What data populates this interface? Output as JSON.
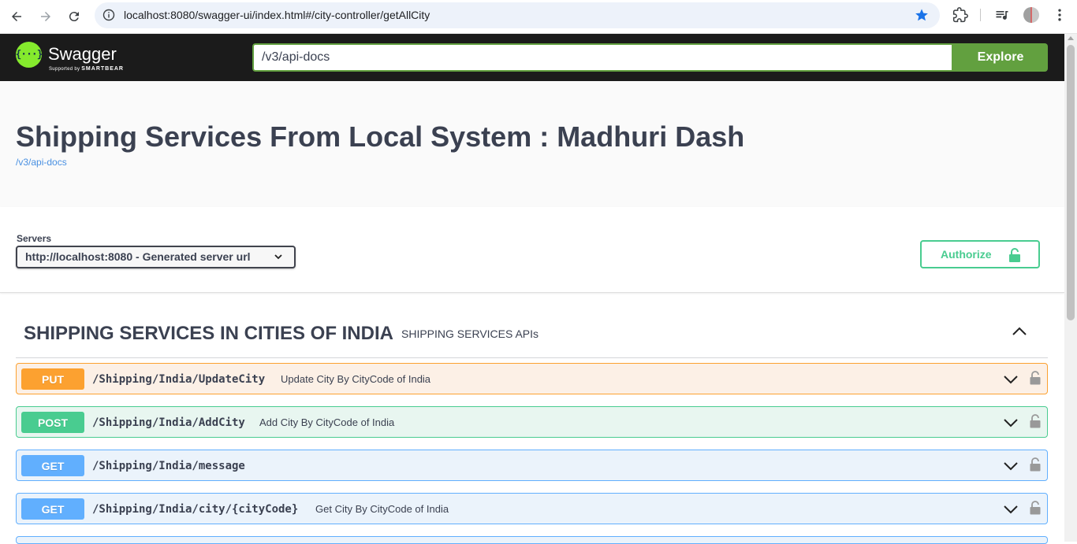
{
  "browser": {
    "url": "localhost:8080/swagger-ui/index.html#/city-controller/getAllCity",
    "icons": [
      "back-icon",
      "forward-icon",
      "reload-icon",
      "site-info-icon",
      "bookmark-star-icon",
      "extensions-icon",
      "media-control-icon",
      "profile-avatar",
      "more-menu-icon"
    ]
  },
  "topbar": {
    "logo_text": "Swagger",
    "logo_sub_prefix": "Supported by",
    "logo_sub_brand": "SMARTBEAR",
    "logo_glyph": "{···}",
    "spec_url": "/v3/api-docs",
    "explore_label": "Explore"
  },
  "info": {
    "title": "Shipping Services From Local System : Madhuri Dash",
    "spec_link": "/v3/api-docs"
  },
  "servers": {
    "label": "Servers",
    "selected": "http://localhost:8080 - Generated server url",
    "authorize_label": "Authorize"
  },
  "tag": {
    "name": "SHIPPING SERVICES IN CITIES OF INDIA",
    "description": "SHIPPING SERVICES APIs"
  },
  "operations": [
    {
      "method": "PUT",
      "path": "/Shipping/India/UpdateCity",
      "summary": "Update City By CityCode of India",
      "color": "#fca130"
    },
    {
      "method": "POST",
      "path": "/Shipping/India/AddCity",
      "summary": "Add City By CityCode of India",
      "color": "#49cc90"
    },
    {
      "method": "GET",
      "path": "/Shipping/India/message",
      "summary": "",
      "color": "#61affe"
    },
    {
      "method": "GET",
      "path": "/Shipping/India/city/{cityCode}",
      "summary": "Get City By CityCode of India",
      "color": "#61affe"
    }
  ]
}
